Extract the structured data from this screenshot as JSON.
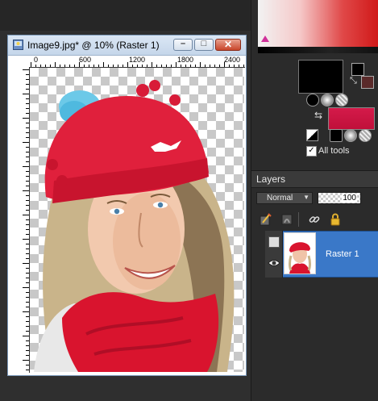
{
  "image_window": {
    "title": "Image9.jpg* @  10% (Raster 1)",
    "min_label": "–",
    "max_label": "□",
    "close_label": "✕"
  },
  "ruler": {
    "top_labels": [
      "0",
      "600",
      "1200",
      "1800",
      "2400"
    ],
    "left_labels": [
      "0",
      "6",
      "1",
      "2",
      "0",
      "0",
      "1",
      "2",
      "0",
      "0",
      "1",
      "8",
      "0",
      "0"
    ]
  },
  "colors": {
    "foreground": "#000000",
    "background": "#d41a4a",
    "accent_selection": "#3a78c8"
  },
  "materials": {
    "all_tools_label": "All tools",
    "all_tools_checked": true
  },
  "layers": {
    "title": "Layers",
    "blend_mode": "Normal",
    "opacity": "100",
    "items": [
      {
        "name": "Raster 1",
        "selected": true,
        "visible": true
      }
    ]
  },
  "icons": {
    "swap": "swap-arrows-icon",
    "eye": "eye-icon",
    "lock": "lock-icon",
    "link": "link-icon"
  }
}
